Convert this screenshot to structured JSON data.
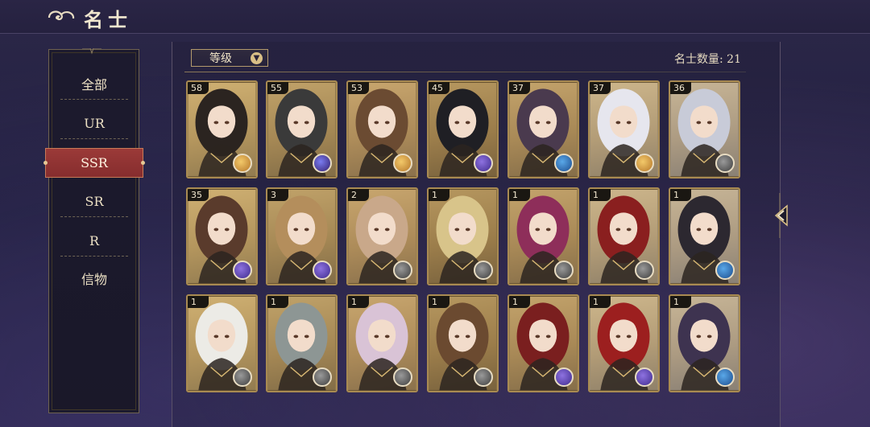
{
  "header": {
    "title": "名士"
  },
  "sidebar": {
    "items": [
      {
        "label": "全部",
        "active": false
      },
      {
        "label": "UR",
        "active": false
      },
      {
        "label": "SSR",
        "active": true
      },
      {
        "label": "SR",
        "active": false
      },
      {
        "label": "R",
        "active": false
      },
      {
        "label": "信物",
        "active": false
      }
    ]
  },
  "toolbar": {
    "sort_label": "等级",
    "count_label": "名士数量: 21"
  },
  "cards": [
    {
      "level": "58",
      "badge": "gold"
    },
    {
      "level": "55",
      "badge": "orb"
    },
    {
      "level": "53",
      "badge": "gold"
    },
    {
      "level": "45",
      "badge": "purple"
    },
    {
      "level": "37",
      "badge": "blue"
    },
    {
      "level": "37",
      "badge": "gold"
    },
    {
      "level": "36",
      "badge": "grey"
    },
    {
      "level": "35",
      "badge": "purple"
    },
    {
      "level": "3",
      "badge": "purple"
    },
    {
      "level": "2",
      "badge": "grey"
    },
    {
      "level": "1",
      "badge": "grey"
    },
    {
      "level": "1",
      "badge": "grey"
    },
    {
      "level": "1",
      "badge": "grey"
    },
    {
      "level": "1",
      "badge": "blue"
    },
    {
      "level": "1",
      "badge": "grey"
    },
    {
      "level": "1",
      "badge": "grey"
    },
    {
      "level": "1",
      "badge": "grey"
    },
    {
      "level": "1",
      "badge": "grey"
    },
    {
      "level": "1",
      "badge": "purple"
    },
    {
      "level": "1",
      "badge": "purple"
    },
    {
      "level": "1",
      "badge": "blue"
    }
  ]
}
